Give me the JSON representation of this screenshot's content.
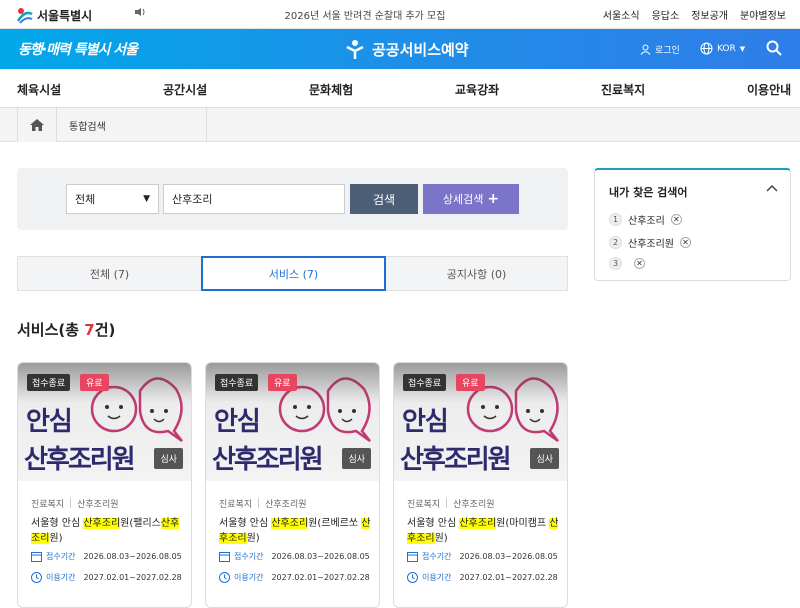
{
  "util": {
    "logo_text": "서울특별시",
    "notice": "2026년 서울 반려견 순찰대 추가 모집",
    "menu": [
      "서울소식",
      "응답소",
      "정보공개",
      "분야별정보"
    ]
  },
  "header": {
    "slogan": "동행·매력 특별시 서울",
    "brand": "공공서비스예약",
    "login": "로그인",
    "lang": "KOR"
  },
  "gnb": [
    "체육시설",
    "공간시설",
    "문화체험",
    "교육강좌",
    "진료복지",
    "이용안내"
  ],
  "breadcrumb": {
    "current": "통합검색"
  },
  "search": {
    "category": "전체",
    "keyword": "산후조리",
    "search_label": "검색",
    "advanced_label": "상세검색"
  },
  "tabs": [
    "전체 (7)",
    "서비스 (7)",
    "공지사항 (0)"
  ],
  "section": {
    "prefix": "서비스(총 ",
    "count": "7",
    "suffix": "건)"
  },
  "cards": [
    {
      "status": "접수종료",
      "fee": "유료",
      "method": "심사",
      "thumb_line1": "안심",
      "thumb_line2": "산후조리원",
      "cat1": "진료복지",
      "cat2": "산후조리원",
      "title_pre": "서울형 안심 ",
      "title_hl1": "산후조리",
      "title_mid": "원(팰리스",
      "title_hl2": "산후조리",
      "title_post": "원)",
      "apply_label": "접수기간",
      "apply": "2026.08.03~2026.08.05",
      "use_label": "이용기간",
      "use": "2027.02.01~2027.02.28"
    },
    {
      "status": "접수종료",
      "fee": "유료",
      "method": "심사",
      "thumb_line1": "안심",
      "thumb_line2": "산후조리원",
      "cat1": "진료복지",
      "cat2": "산후조리원",
      "title_pre": "서울형 안심 ",
      "title_hl1": "산후조리",
      "title_mid": "원(르베르쏘 ",
      "title_hl2": "산후조리",
      "title_post": "원)",
      "apply_label": "접수기간",
      "apply": "2026.08.03~2026.08.05",
      "use_label": "이용기간",
      "use": "2027.02.01~2027.02.28"
    },
    {
      "status": "접수종료",
      "fee": "유료",
      "method": "심사",
      "thumb_line1": "안심",
      "thumb_line2": "산후조리원",
      "cat1": "진료복지",
      "cat2": "산후조리원",
      "title_pre": "서울형 안심 ",
      "title_hl1": "산후조리",
      "title_mid": "원(마미캠프 ",
      "title_hl2": "산후조리",
      "title_post": "원)",
      "apply_label": "접수기간",
      "apply": "2026.08.03~2026.08.05",
      "use_label": "이용기간",
      "use": "2027.02.01~2027.02.28"
    }
  ],
  "recent": {
    "title": "내가 찾은 검색어",
    "items": [
      {
        "num": "1",
        "text": "산후조리"
      },
      {
        "num": "2",
        "text": "산후조리원"
      },
      {
        "num": "3",
        "text": ""
      }
    ]
  },
  "colors": {
    "header_blue": "#1e8fe8",
    "search_btn": "#4d5f76",
    "adv_btn": "#7b74c9",
    "tab_active": "#1f6fd0",
    "count_red": "#e0313f",
    "highlight": "#ffff00"
  },
  "icons": [
    "seoul-logo-icon",
    "speaker-icon",
    "brand-icon",
    "user-icon",
    "globe-icon",
    "search-icon",
    "home-icon",
    "chevron-up-icon",
    "calendar-icon",
    "clock-icon",
    "close-icon"
  ]
}
